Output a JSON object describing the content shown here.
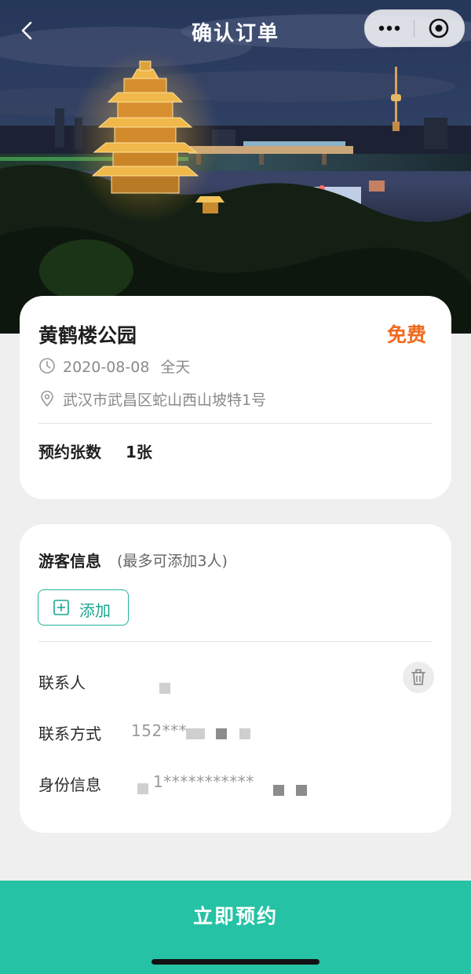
{
  "nav": {
    "title": "确认订单"
  },
  "icons": {
    "back": "chevron-left-icon",
    "more": "more-dots-icon",
    "close": "target-circle-icon",
    "clock": "clock-icon",
    "location": "location-pin-icon",
    "add": "plus-square-icon",
    "delete": "trash-icon"
  },
  "colors": {
    "accent": "#26c2a5",
    "price": "#f06a1e",
    "add_border": "#22b39a"
  },
  "attraction": {
    "name": "黄鹤楼公园",
    "price": "免费",
    "date": "2020-08-08",
    "session": "全天",
    "address": "武汉市武昌区蛇山西山坡特1号",
    "ticket_label": "预约张数",
    "ticket_count": "1张"
  },
  "visitor": {
    "title": "游客信息",
    "note": "(最多可添加3人)",
    "add_label": "添加",
    "contact_label": "联系人",
    "phone_label": "联系方式",
    "phone_value": "152***",
    "id_label": "身份信息",
    "id_value": "1***********"
  },
  "footer": {
    "submit_label": "立即预约"
  }
}
